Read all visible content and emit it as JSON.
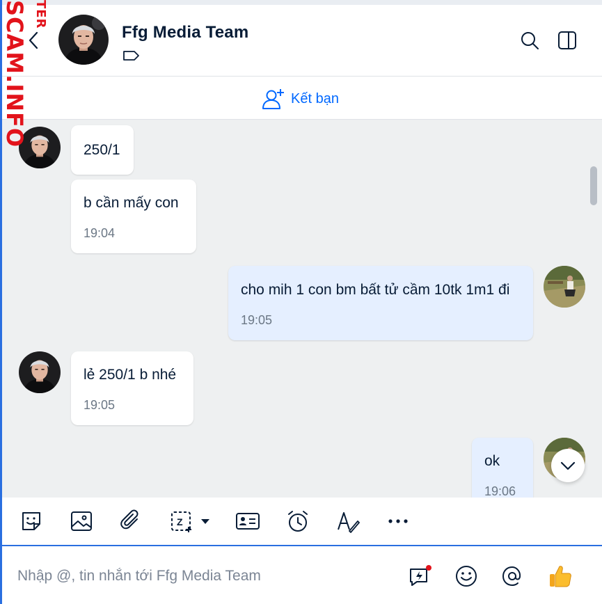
{
  "watermark": {
    "small": "TER",
    "big": "SCAM.INFO"
  },
  "header": {
    "title": "Ffg Media Team",
    "back_icon": "chevron-left-icon",
    "tag_icon": "tag-icon",
    "actions": [
      "search-icon",
      "side-panel-icon"
    ]
  },
  "friend_bar": {
    "label": "Kết bạn",
    "icon": "add-user-icon"
  },
  "messages": [
    {
      "from": "them",
      "text": "250/1",
      "time": ""
    },
    {
      "from": "them",
      "text": "b cần mấy con",
      "time": "19:04"
    },
    {
      "from": "me",
      "text": "cho mih 1 con bm bất tử cầm 10tk 1m1 đi",
      "time": "19:05"
    },
    {
      "from": "them",
      "text": "lẻ 250/1 b nhé",
      "time": "19:05"
    },
    {
      "from": "me",
      "text": "ok",
      "time": "19:06"
    }
  ],
  "toolbar": {
    "items": [
      "sticker-icon",
      "image-icon",
      "attachment-icon",
      "screenshot-icon",
      "contact-card-icon",
      "reminder-clock-icon",
      "text-format-icon",
      "more-icon"
    ]
  },
  "composer": {
    "placeholder": "Nhập @, tin nhắn tới Ffg Media Team",
    "icons": [
      "quick-message-icon",
      "emoji-icon",
      "mention-icon",
      "thumbs-up-icon"
    ]
  },
  "colors": {
    "accent": "#0068ff",
    "my_bubble": "#e5efff",
    "their_bubble": "#ffffff",
    "chat_bg": "#eef0f1",
    "watermark": "#e2131b"
  }
}
